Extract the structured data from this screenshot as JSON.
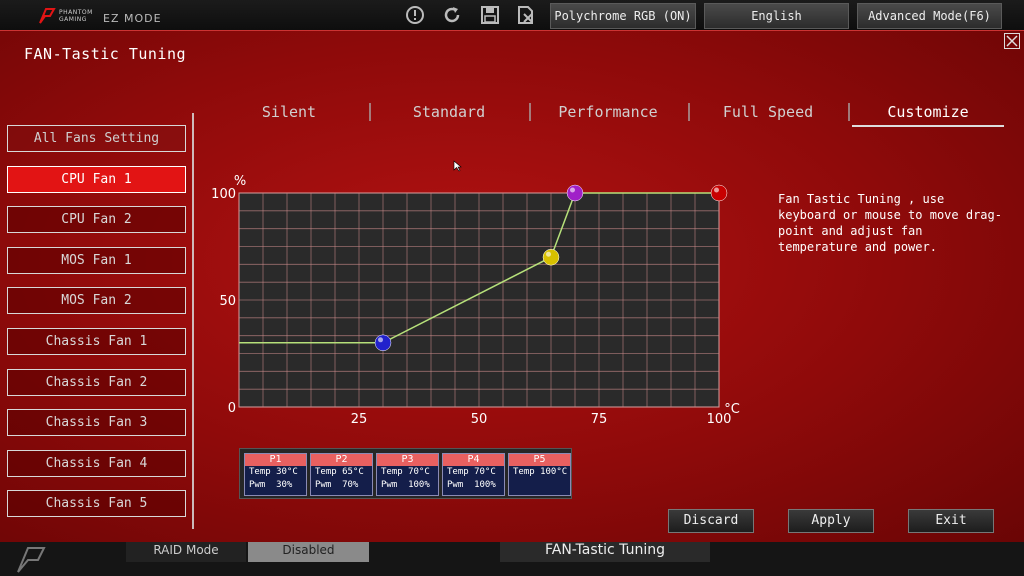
{
  "topbar": {
    "brand_line1": "PHANTOM",
    "brand_line2": "GAMING",
    "mode": "EZ MODE",
    "polychrome": "Polychrome RGB (ON)",
    "language": "English",
    "advanced": "Advanced Mode(F6)"
  },
  "panel": {
    "title": "FAN-Tastic Tuning"
  },
  "fans": [
    "All Fans Setting",
    "CPU Fan 1",
    "CPU Fan 2",
    "MOS Fan 1",
    "MOS Fan 2",
    "Chassis Fan 1",
    "Chassis Fan 2",
    "Chassis Fan 3",
    "Chassis Fan 4",
    "Chassis Fan 5"
  ],
  "active_fan": "CPU Fan 1",
  "tabs": [
    "Silent",
    "Standard",
    "Performance",
    "Full Speed",
    "Customize"
  ],
  "active_tab": "Customize",
  "description": "Fan Tastic Tuning , use keyboard or mouse to move drag-point and adjust fan temperature and power.",
  "points": [
    {
      "label": "P1",
      "temp": "Temp 30°C",
      "pwm": "Pwm  30%"
    },
    {
      "label": "P2",
      "temp": "Temp 65°C",
      "pwm": "Pwm  70%"
    },
    {
      "label": "P3",
      "temp": "Temp 70°C",
      "pwm": "Pwm  100%"
    },
    {
      "label": "P4",
      "temp": "Temp 70°C",
      "pwm": "Pwm  100%"
    },
    {
      "label": "P5",
      "temp": "Temp 100°C",
      "pwm": ""
    }
  ],
  "buttons": {
    "discard": "Discard",
    "apply": "Apply",
    "exit": "Exit"
  },
  "bottom": {
    "raid_label": "RAID Mode",
    "raid_value": "Disabled",
    "fan_tuning": "FAN-Tastic Tuning"
  },
  "chart_data": {
    "type": "line",
    "y_unit": "%",
    "x_unit": "°C",
    "yticks": [
      "0",
      "50",
      "100"
    ],
    "xticks": [
      "25",
      "50",
      "75",
      "100"
    ],
    "xlim": [
      0,
      100
    ],
    "ylim": [
      0,
      100
    ],
    "grid": true,
    "series": [
      {
        "x": [
          0,
          30,
          65,
          70,
          100
        ],
        "y": [
          30,
          30,
          70,
          100,
          100
        ]
      }
    ],
    "point_colors": [
      "#2222cc",
      "#d8c000",
      "#a020c8",
      "#c80000"
    ]
  },
  "colors": {
    "accent": "#e21414",
    "panel": "#a50e0e",
    "grid": "#c98a8a",
    "curve": "#b6e07a"
  }
}
